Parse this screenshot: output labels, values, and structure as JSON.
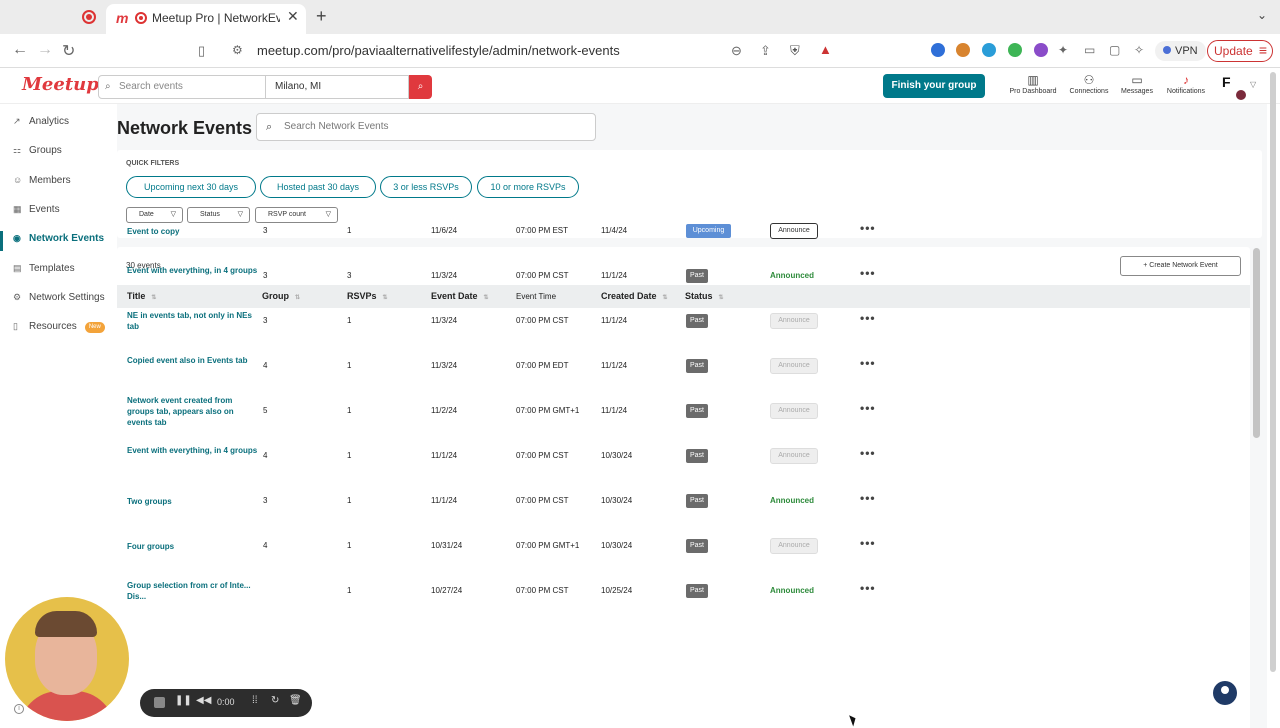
{
  "browser": {
    "tab_title": "Meetup Pro | NetworkEven",
    "tab_logo": "m",
    "url": "meetup.com/pro/paviaalternativelifestyle/admin/network-events",
    "vpn_label": "VPN",
    "update_label": "Update"
  },
  "header": {
    "logo": "Meetup",
    "search_placeholder": "Search events",
    "location": "Milano, MI",
    "finish_label": "Finish your group",
    "nav": [
      {
        "label": "Pro Dashboard",
        "icon": "chart-icon"
      },
      {
        "label": "Connections",
        "icon": "people-icon"
      },
      {
        "label": "Messages",
        "icon": "chat-icon"
      },
      {
        "label": "Notifications",
        "icon": "bell-icon"
      }
    ],
    "avatar_initial": "F"
  },
  "sidebar": {
    "items": [
      {
        "label": "Analytics",
        "icon": "analytics-icon"
      },
      {
        "label": "Groups",
        "icon": "groups-icon"
      },
      {
        "label": "Members",
        "icon": "members-icon"
      },
      {
        "label": "Events",
        "icon": "calendar-icon"
      },
      {
        "label": "Network Events",
        "icon": "network-icon",
        "active": true
      },
      {
        "label": "Templates",
        "icon": "templates-icon"
      },
      {
        "label": "Network Settings",
        "icon": "settings-icon"
      },
      {
        "label": "Resources",
        "icon": "resources-icon",
        "badge": "New"
      }
    ]
  },
  "page": {
    "title": "Network Events",
    "search_placeholder": "Search Network Events"
  },
  "filters": {
    "quick_label": "QUICK FILTERS",
    "pills": [
      "Upcoming next 30 days",
      "Hosted past 30 days",
      "3 or less RSVPs",
      "10 or more RSVPs"
    ],
    "dropdowns": [
      "Date",
      "Status",
      "RSVP count"
    ]
  },
  "table": {
    "count": "30 events",
    "create_label": "Create Network Event",
    "columns": [
      "Title",
      "Group",
      "RSVPs",
      "Event Date",
      "Event Time",
      "Created Date",
      "Status"
    ],
    "rows": [
      {
        "title": "Event to copy",
        "group": "3",
        "rsvps": "1",
        "date": "11/6/24",
        "time": "07:00 PM EST",
        "created": "11/4/24",
        "status": "Upcoming",
        "announce": "button"
      },
      {
        "title": "Event with everything, in 4 groups",
        "group": "3",
        "rsvps": "3",
        "date": "11/3/24",
        "time": "07:00 PM CST",
        "created": "11/1/24",
        "status": "Past",
        "announce": "done"
      },
      {
        "title": "NE in events tab, not only in NEs tab",
        "group": "3",
        "rsvps": "1",
        "date": "11/3/24",
        "time": "07:00 PM CST",
        "created": "11/1/24",
        "status": "Past",
        "announce": "disabled"
      },
      {
        "title": "Copied event also in Events tab",
        "group": "4",
        "rsvps": "1",
        "date": "11/3/24",
        "time": "07:00 PM EDT",
        "created": "11/1/24",
        "status": "Past",
        "announce": "disabled"
      },
      {
        "title": "Network event created from groups tab, appears also on events tab",
        "group": "5",
        "rsvps": "1",
        "date": "11/2/24",
        "time": "07:00 PM GMT+1",
        "created": "11/1/24",
        "status": "Past",
        "announce": "disabled"
      },
      {
        "title": "Event with everything, in 4 groups",
        "group": "4",
        "rsvps": "1",
        "date": "11/1/24",
        "time": "07:00 PM CST",
        "created": "10/30/24",
        "status": "Past",
        "announce": "disabled"
      },
      {
        "title": "Two groups",
        "group": "3",
        "rsvps": "1",
        "date": "11/1/24",
        "time": "07:00 PM CST",
        "created": "10/30/24",
        "status": "Past",
        "announce": "done"
      },
      {
        "title": "Four groups",
        "group": "4",
        "rsvps": "1",
        "date": "10/31/24",
        "time": "07:00 PM GMT+1",
        "created": "10/30/24",
        "status": "Past",
        "announce": "disabled"
      },
      {
        "title": "Group selection from cr of Inte... Dis...",
        "group": "",
        "rsvps": "1",
        "date": "10/27/24",
        "time": "07:00 PM CST",
        "created": "10/25/24",
        "status": "Past",
        "announce": "done"
      }
    ],
    "announce_label": "Announce",
    "announced_label": "Announced"
  },
  "recorder": {
    "time": "0:00"
  },
  "colors": {
    "brand": "#e0393e",
    "teal": "#00798a",
    "upcoming": "#5d8fd6",
    "past": "#6b6b6b",
    "announced": "#2e8b3b"
  }
}
